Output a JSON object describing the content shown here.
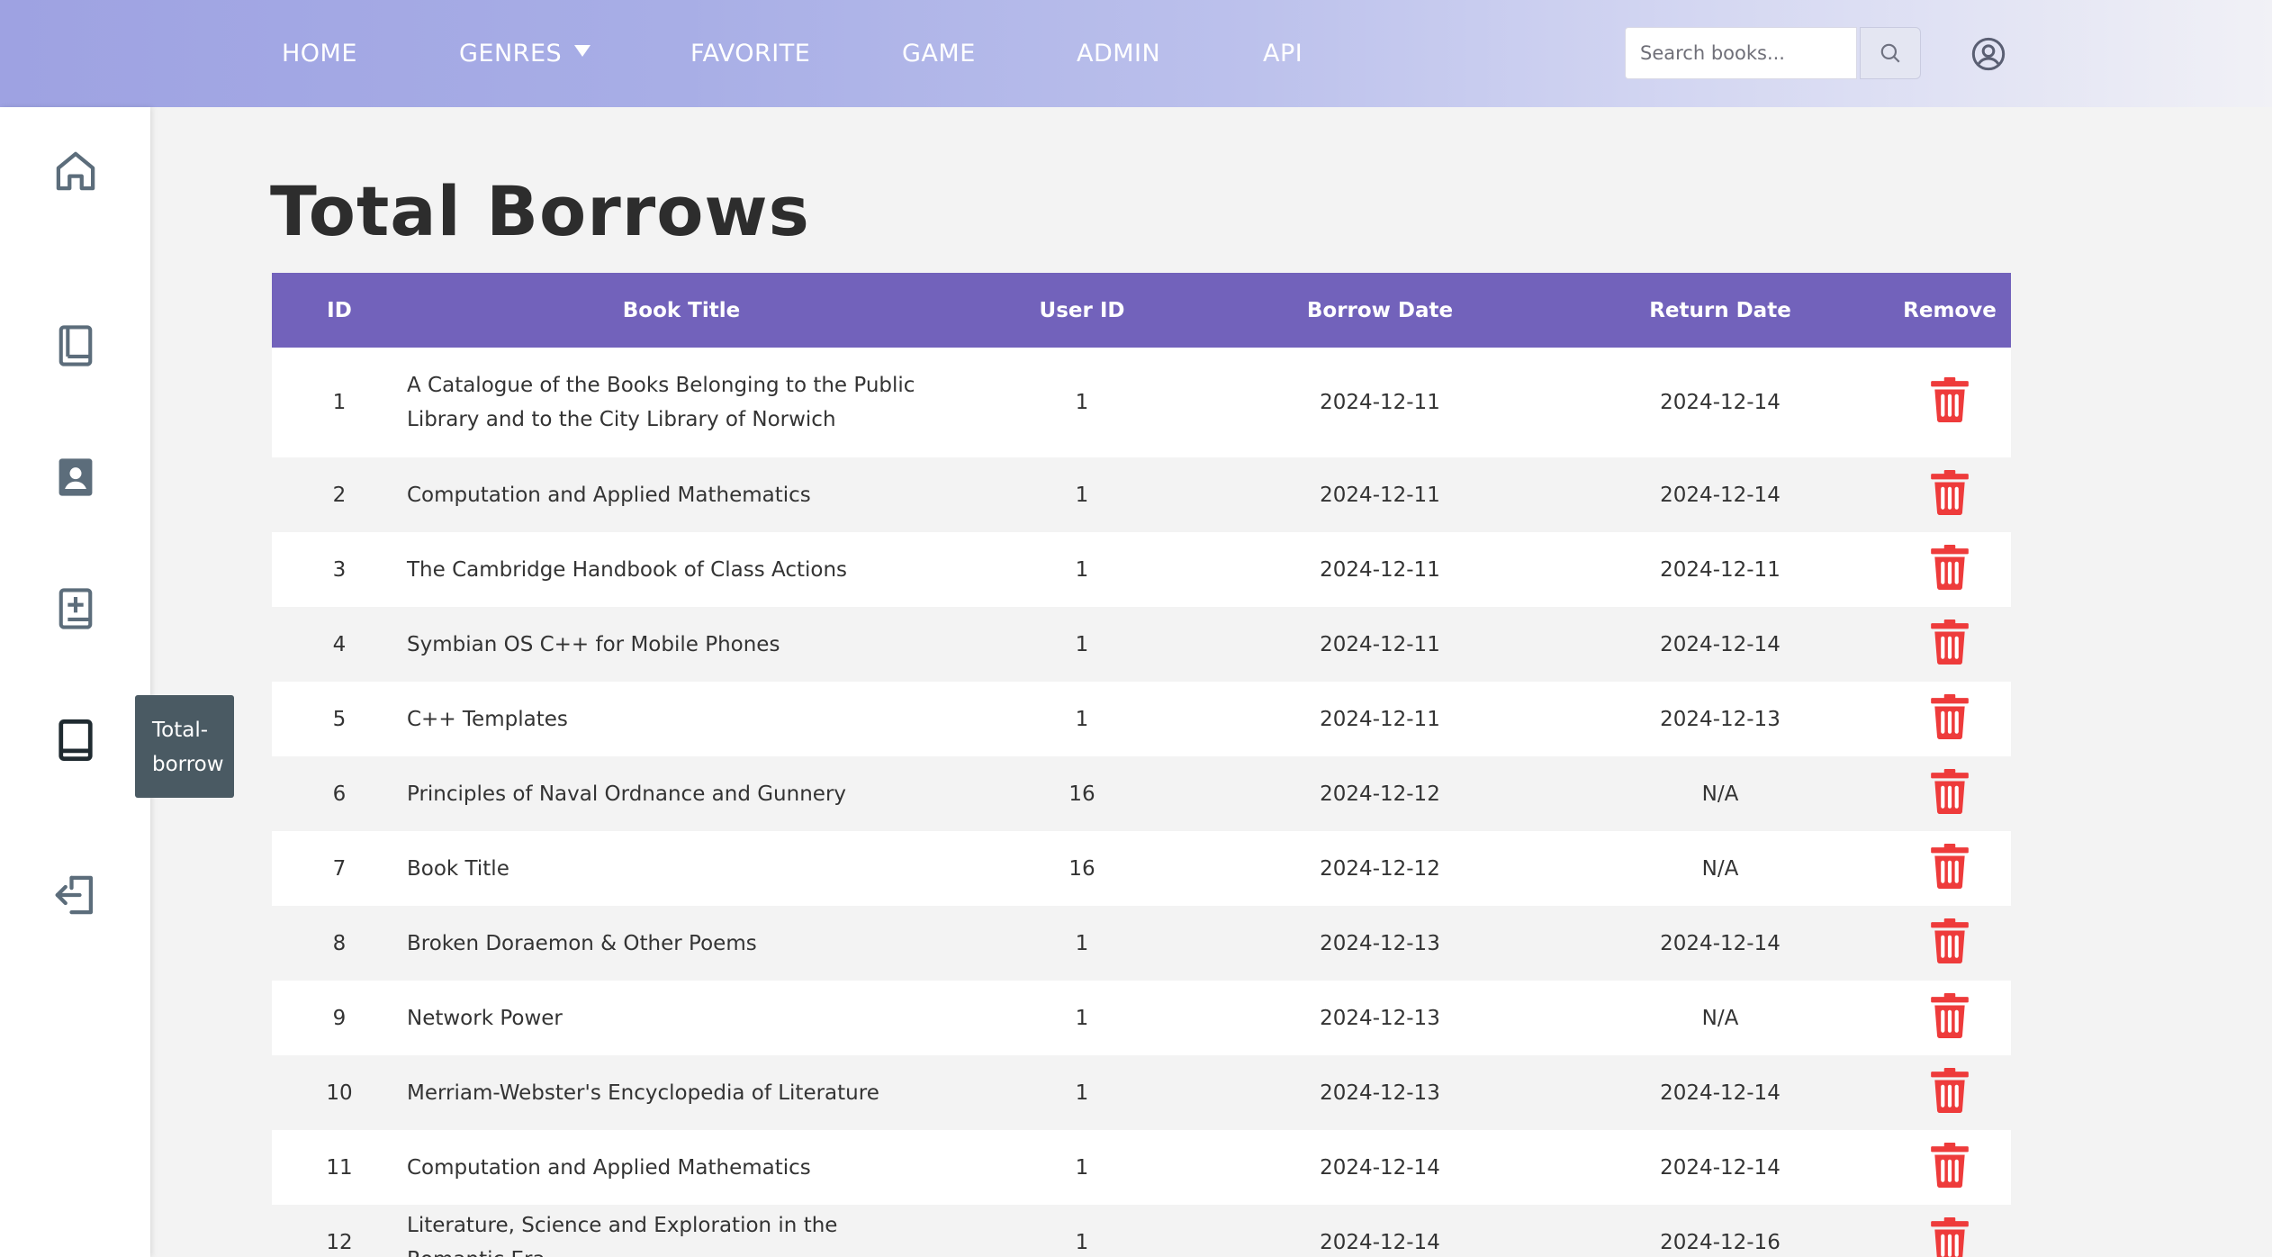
{
  "nav": {
    "links": [
      {
        "label": "HOME"
      },
      {
        "label": "GENRES"
      },
      {
        "label": "FAVORITE"
      },
      {
        "label": "GAME"
      },
      {
        "label": "ADMIN"
      },
      {
        "label": "API"
      }
    ],
    "search": {
      "placeholder": "Search books...",
      "icon": "search-icon"
    },
    "user_icon": "user-circle-icon"
  },
  "sidebar": {
    "items": [
      {
        "icon": "home-icon"
      },
      {
        "icon": "book-icon"
      },
      {
        "icon": "contact-card-icon"
      },
      {
        "icon": "add-book-icon"
      },
      {
        "icon": "total-borrow-icon"
      },
      {
        "icon": "logout-icon"
      }
    ],
    "tooltip": {
      "line1": "Total-",
      "line2": "borrow"
    }
  },
  "page": {
    "title": "Total Borrows"
  },
  "table": {
    "headers": {
      "id": "ID",
      "title": "Book Title",
      "user_id": "User ID",
      "borrow_date": "Borrow Date",
      "return_date": "Return Date",
      "remove": "Remove"
    },
    "rows": [
      {
        "id": "1",
        "title_line1": "A Catalogue of the Books Belonging to the Public",
        "title_line2": "Library and to the City Library of Norwich",
        "user_id": "1",
        "borrow_date": "2024-12-11",
        "return_date": "2024-12-14"
      },
      {
        "id": "2",
        "title_line1": "Computation and Applied Mathematics",
        "user_id": "1",
        "borrow_date": "2024-12-11",
        "return_date": "2024-12-14"
      },
      {
        "id": "3",
        "title_line1": "The Cambridge Handbook of Class Actions",
        "user_id": "1",
        "borrow_date": "2024-12-11",
        "return_date": "2024-12-11"
      },
      {
        "id": "4",
        "title_line1": "Symbian OS C++ for Mobile Phones",
        "user_id": "1",
        "borrow_date": "2024-12-11",
        "return_date": "2024-12-14"
      },
      {
        "id": "5",
        "title_line1": "C++ Templates",
        "user_id": "1",
        "borrow_date": "2024-12-11",
        "return_date": "2024-12-13"
      },
      {
        "id": "6",
        "title_line1": "Principles of Naval Ordnance and Gunnery",
        "user_id": "16",
        "borrow_date": "2024-12-12",
        "return_date": "N/A"
      },
      {
        "id": "7",
        "title_line1": "Book Title",
        "user_id": "16",
        "borrow_date": "2024-12-12",
        "return_date": "N/A"
      },
      {
        "id": "8",
        "title_line1": "Broken Doraemon & Other Poems",
        "user_id": "1",
        "borrow_date": "2024-12-13",
        "return_date": "2024-12-14"
      },
      {
        "id": "9",
        "title_line1": "Network Power",
        "user_id": "1",
        "borrow_date": "2024-12-13",
        "return_date": "N/A"
      },
      {
        "id": "10",
        "title_line1": "Merriam-Webster's Encyclopedia of Literature",
        "user_id": "1",
        "borrow_date": "2024-12-13",
        "return_date": "2024-12-14"
      },
      {
        "id": "11",
        "title_line1": "Computation and Applied Mathematics",
        "user_id": "1",
        "borrow_date": "2024-12-14",
        "return_date": "2024-12-14"
      },
      {
        "id": "12",
        "title_line1": "Literature, Science and Exploration in the Romantic Era",
        "user_id": "1",
        "borrow_date": "2024-12-14",
        "return_date": "2024-12-16"
      }
    ],
    "remove_icon": "trash-icon"
  },
  "colors": {
    "header_bg": "#7262bb",
    "trash": "#ee3b3b",
    "sidebar_icon": "#5c6d7b",
    "sidebar_active_icon": "#1f2a30",
    "tooltip_bg": "#4a5a63"
  }
}
